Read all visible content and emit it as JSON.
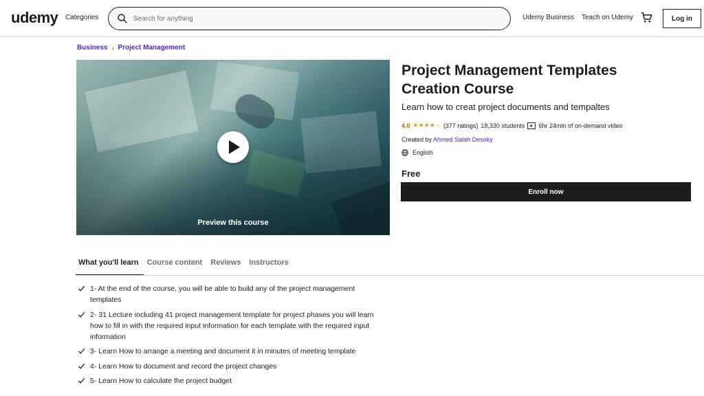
{
  "header": {
    "logo": "udemy",
    "categories_label": "Categories",
    "search_placeholder": "Search for anything",
    "udemy_business": "Udemy Business",
    "teach": "Teach on Udemy",
    "cart_icon": "cart-icon",
    "login_label": "Log in"
  },
  "breadcrumb": [
    "Business",
    "Project Management"
  ],
  "preview": {
    "label": "Preview this course",
    "play_icon": "play-icon"
  },
  "course": {
    "title": "Project Management Templates Creation Course",
    "subtitle": "Learn how to creat project documents and tempaltes",
    "rating": "4.0",
    "stars": "★★★★☆",
    "ratings_count": "(377 ratings)",
    "students": "18,330 students",
    "duration": "6hr 24min of on-demand video",
    "created_by_label": "Created by",
    "author": "Ahmed Salah Desoky",
    "language": "English",
    "price": "Free",
    "enroll_label": "Enroll now"
  },
  "tabs": [
    "What you'll learn",
    "Course content",
    "Reviews",
    "Instructors"
  ],
  "learn_items": [
    "1- At the end of the course, you will be able to build any of the project management templates",
    "2- 31 Lecture including 41 project management template for project phases you will learn how to fill in with the required input information for each template with the required input information",
    "3- Learn How to arrange a meeting and document it in minutes of meeting template",
    "4- Learn How to document and record the project changes",
    "5- Learn How to calculate the project budget"
  ],
  "colors": {
    "accent": "#a435f0",
    "link": "#5624d0",
    "rating": "#b4690e",
    "star": "#e59819",
    "dark": "#1c1d1f"
  }
}
